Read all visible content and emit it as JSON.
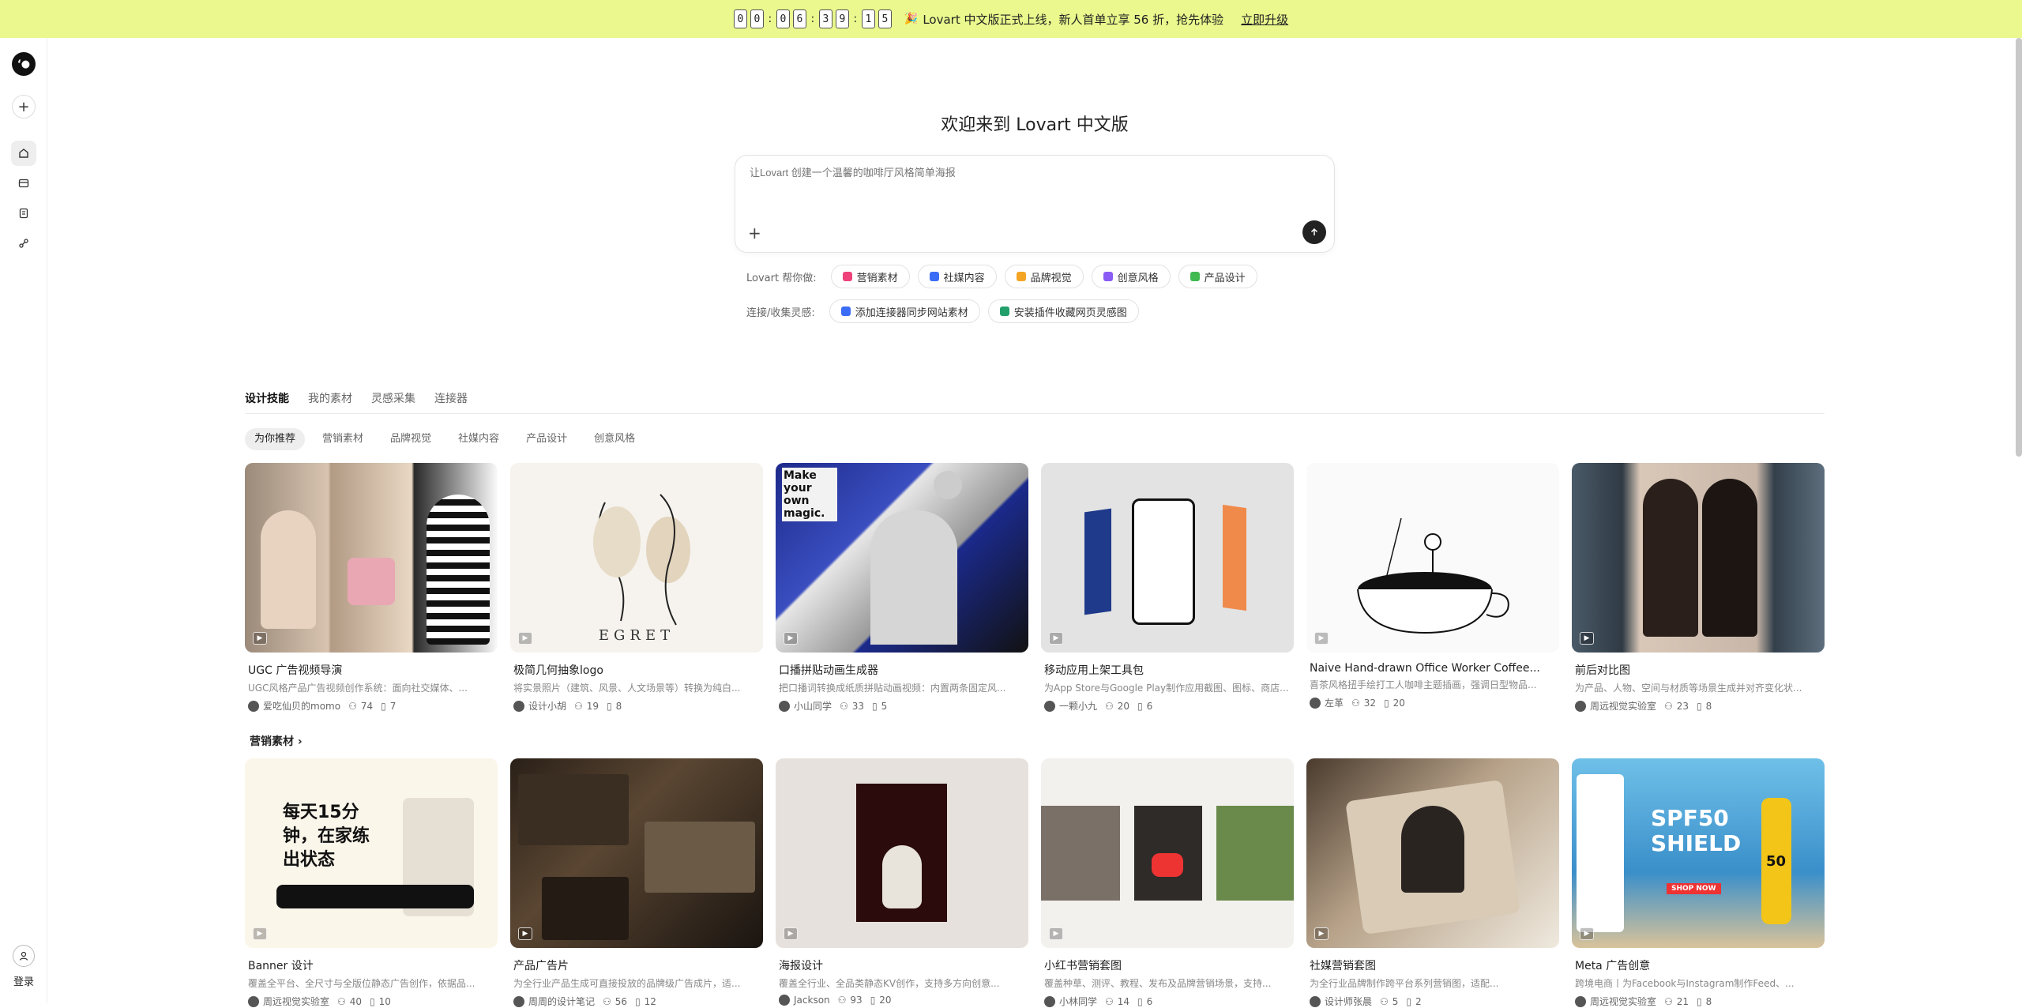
{
  "banner": {
    "countdown": [
      "0",
      "0",
      ":",
      "0",
      "6",
      ":",
      "3",
      "9",
      ":",
      "1",
      "5"
    ],
    "text": "Lovart 中文版正式上线，新人首单立享 56 折，抢先体验",
    "cta": "立即升级"
  },
  "sidebar": {
    "login": "登录"
  },
  "hero": {
    "title": "欢迎来到 Lovart 中文版",
    "placeholder": "让Lovart 创建一个温馨的咖啡厅风格简单海报"
  },
  "help_row": {
    "label": "Lovart 帮你做:",
    "chips": [
      {
        "label": "营销素材",
        "color": "#f0427a"
      },
      {
        "label": "社媒内容",
        "color": "#3b6cf5"
      },
      {
        "label": "品牌视觉",
        "color": "#f5a524"
      },
      {
        "label": "创意风格",
        "color": "#8a5cf5"
      },
      {
        "label": "产品设计",
        "color": "#3fb950"
      }
    ]
  },
  "connect_row": {
    "label": "连接/收集灵感:",
    "chips": [
      {
        "label": "添加连接器同步网站素材",
        "color": "#3b6cf5"
      },
      {
        "label": "安装插件收藏网页灵感图",
        "color": "#22a06b"
      }
    ]
  },
  "tabs": [
    "设计技能",
    "我的素材",
    "灵感采集",
    "连接器"
  ],
  "subtabs": [
    "为你推荐",
    "营销素材",
    "品牌视觉",
    "社媒内容",
    "产品设计",
    "创意风格"
  ],
  "row1": [
    {
      "title": "UGC 广告视频导演",
      "desc": "UGC风格产品广告视频创作系统：面向社交媒体、...",
      "author": "爱吃仙贝的momo",
      "users": "74",
      "saves": "7"
    },
    {
      "title": "极简几何抽象logo",
      "desc": "将实景照片（建筑、风景、人文场景等）转换为纯白...",
      "author": "设计小胡",
      "users": "19",
      "saves": "8"
    },
    {
      "title": "口播拼贴动画生成器",
      "desc": "把口播词转换成纸质拼贴动画视频：内置两条固定风...",
      "author": "小山同学",
      "users": "33",
      "saves": "5"
    },
    {
      "title": "移动应用上架工具包",
      "desc": "为App Store与Google Play制作应用截图、图标、商店...",
      "author": "一颗小九",
      "users": "20",
      "saves": "6"
    },
    {
      "title": "Naive Hand-drawn Office Worker Coffee...",
      "desc": "喜茶风格扭手绘打工人咖啡主题插画，强调日型物品...",
      "author": "左革",
      "users": "32",
      "saves": "20"
    },
    {
      "title": "前后对比图",
      "desc": "为产品、人物、空间与材质等场景生成并对齐变化状...",
      "author": "周远视觉实验室",
      "users": "23",
      "saves": "8"
    }
  ],
  "section2": {
    "title": "营销素材 ›"
  },
  "row2": [
    {
      "title": "Banner 设计",
      "desc": "覆盖全平台、全尺寸与全版位静态广告创作，依据品...",
      "author": "周远视觉实验室",
      "users": "40",
      "saves": "10"
    },
    {
      "title": "产品广告片",
      "desc": "为全行业产品生成可直接投放的品牌级广告成片，适...",
      "author": "周周的设计笔记",
      "users": "56",
      "saves": "12"
    },
    {
      "title": "海报设计",
      "desc": "覆盖全行业、全品类静态KV创作，支持多方向创意...",
      "author": "Jackson",
      "users": "93",
      "saves": "20"
    },
    {
      "title": "小红书营销套图",
      "desc": "覆盖种草、测评、教程、发布及品牌营销场景，支持...",
      "author": "小林同学",
      "users": "14",
      "saves": "6"
    },
    {
      "title": "社媒营销套图",
      "desc": "为全行业品牌制作跨平台系列营销图，适配...",
      "author": "设计师张晨",
      "users": "5",
      "saves": "2"
    },
    {
      "title": "Meta 广告创意",
      "desc": "跨境电商丨为Facebook与Instagram制作Feed、...",
      "author": "周远视觉实验室",
      "users": "21",
      "saves": "8"
    }
  ],
  "thumb_text": {
    "magic": "Make your own magic.",
    "egret": "EGRET",
    "banner_cn": "每天15分钟，在家练出状态",
    "spf": "SPF50 SHIELD",
    "shop": "SHOP NOW",
    "spf_num": "50"
  }
}
